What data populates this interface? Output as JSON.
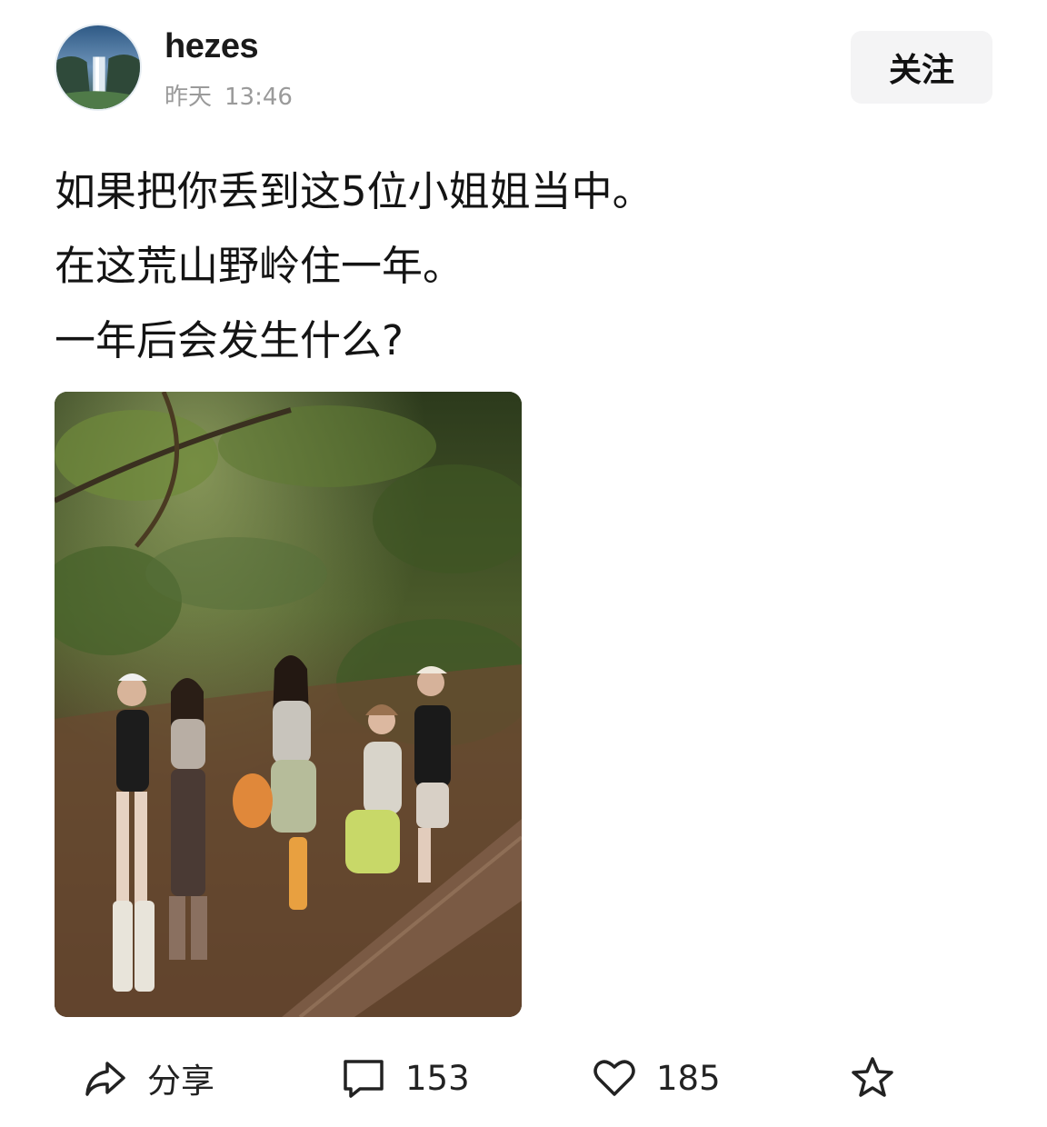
{
  "post": {
    "author": {
      "name": "hezes",
      "date": "昨天",
      "time": "13:46"
    },
    "follow_label": "关注",
    "text_lines": [
      "如果把你丢到这5位小姐姐当中。",
      "在这荒山野岭住一年。",
      "一年后会发生什么?"
    ]
  },
  "actions": {
    "share": {
      "icon": "share-icon",
      "label": "分享"
    },
    "comment": {
      "icon": "comment-icon",
      "count": "153"
    },
    "like": {
      "icon": "heart-icon",
      "count": "185"
    },
    "favorite": {
      "icon": "star-icon"
    }
  },
  "colors": {
    "background": "#ffffff",
    "text": "#141414",
    "muted": "#9a9a9a",
    "button_bg": "#f4f4f5"
  }
}
